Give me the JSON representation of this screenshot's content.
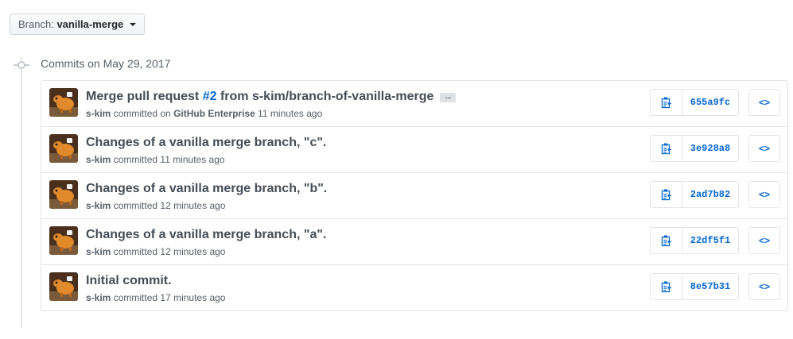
{
  "branch": {
    "prefix": "Branch:",
    "value": "vanilla-merge"
  },
  "group": {
    "title": "Commits on May 29, 2017"
  },
  "commits": [
    {
      "title_pre": "Merge pull request ",
      "title_link": "#2",
      "title_post": " from s-kim/branch-of-vanilla-merge",
      "has_ellipsis": true,
      "author": "s-kim",
      "action": "committed on",
      "via": "GitHub Enterprise",
      "time": "11 minutes ago",
      "sha": "655a9fc"
    },
    {
      "title_pre": "Changes of a vanilla merge branch, \"c\".",
      "title_link": "",
      "title_post": "",
      "has_ellipsis": false,
      "author": "s-kim",
      "action": "committed",
      "via": "",
      "time": "11 minutes ago",
      "sha": "3e928a8"
    },
    {
      "title_pre": "Changes of a vanilla merge branch, \"b\".",
      "title_link": "",
      "title_post": "",
      "has_ellipsis": false,
      "author": "s-kim",
      "action": "committed",
      "via": "",
      "time": "12 minutes ago",
      "sha": "2ad7b82"
    },
    {
      "title_pre": "Changes of a vanilla merge branch, \"a\".",
      "title_link": "",
      "title_post": "",
      "has_ellipsis": false,
      "author": "s-kim",
      "action": "committed",
      "via": "",
      "time": "12 minutes ago",
      "sha": "22df5f1"
    },
    {
      "title_pre": "Initial commit.",
      "title_link": "",
      "title_post": "",
      "has_ellipsis": false,
      "author": "s-kim",
      "action": "committed",
      "via": "",
      "time": "17 minutes ago",
      "sha": "8e57b31"
    }
  ],
  "icons": {
    "copy": "clipboard-icon",
    "browse": "code-icon",
    "caret": "caret-down-icon",
    "ellipsis": "ellipsis-icon"
  },
  "browse_glyph": "<>",
  "ellipsis_glyph": "...",
  "colors": {
    "link": "#0366d6",
    "border": "#e1e4e8",
    "muted": "#586069",
    "avatar_bg": "#5a3a22",
    "avatar_fg": "#e08a2c"
  }
}
